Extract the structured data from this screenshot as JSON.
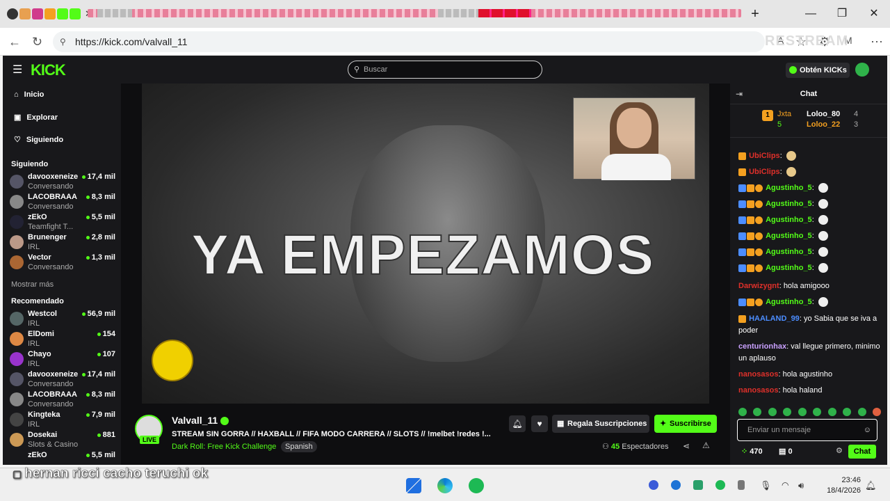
{
  "browser": {
    "url": "https://kick.com/valvall_11",
    "watermark": "RESTREAM",
    "window_controls": {
      "minimize": "—",
      "restore": "❐",
      "close": "✕"
    },
    "new_tab": "+"
  },
  "app": {
    "logo": "KICK",
    "search_placeholder": "Buscar",
    "kicks_label": "Obtén KICKs",
    "nav": [
      {
        "label": "Inicio",
        "icon": "home-icon"
      },
      {
        "label": "Explorar",
        "icon": "explore-icon"
      },
      {
        "label": "Siguiendo",
        "icon": "heart-icon"
      }
    ],
    "following_heading": "Siguiendo",
    "following": [
      {
        "name": "davooxeneize",
        "category": "Conversando",
        "viewers": "17,4 mil"
      },
      {
        "name": "LACOBRAAA",
        "category": "Conversando",
        "viewers": "8,3 mil"
      },
      {
        "name": "zEkO",
        "category": "Teamfight T...",
        "viewers": "5,5 mil"
      },
      {
        "name": "Brunenger",
        "category": "IRL",
        "viewers": "2,8 mil"
      },
      {
        "name": "Vector",
        "category": "Conversando",
        "viewers": "1,3 mil"
      }
    ],
    "show_more": "Mostrar más",
    "recommended_heading": "Recomendado",
    "recommended": [
      {
        "name": "Westcol",
        "category": "IRL",
        "viewers": "56,9 mil"
      },
      {
        "name": "ElDomi",
        "category": "IRL",
        "viewers": "154"
      },
      {
        "name": "Chayo",
        "category": "IRL",
        "viewers": "107"
      },
      {
        "name": "davooxeneize",
        "category": "Conversando",
        "viewers": "17,4 mil"
      },
      {
        "name": "LACOBRAAA",
        "category": "Conversando",
        "viewers": "8,3 mil"
      },
      {
        "name": "Kingteka",
        "category": "IRL",
        "viewers": "7,9 mil"
      },
      {
        "name": "Dosekai",
        "category": "Slots & Casino",
        "viewers": "881"
      },
      {
        "name": "zEkO",
        "category": "",
        "viewers": "5,5 mil"
      }
    ]
  },
  "video": {
    "overlay_text": "YA EMPEZAMOS"
  },
  "stream": {
    "channel": "Valvall_11",
    "live_badge": "LIVE",
    "title": "STREAM SIN GORRA // HAXBALL // FIFA MODO CARRERA // SLOTS // !melbet !redes !...",
    "category": "Dark Roll: Free Kick Challenge",
    "language_tag": "Spanish",
    "gift_label": "Regala Suscripciones",
    "subscribe_label": "Suscribirse",
    "viewers_count": "45",
    "viewers_label": "Espectadores"
  },
  "chat": {
    "heading": "Chat",
    "leaderboard": [
      {
        "name": "Jxta",
        "score": "5"
      },
      {
        "name": "Loloo_80",
        "score": "4"
      },
      {
        "name": "Loloo_22",
        "score": "3"
      }
    ],
    "messages": [
      {
        "user": "UbiClips",
        "text": "",
        "color": "#e0302a"
      },
      {
        "user": "UbiClips",
        "text": "",
        "color": "#e0302a"
      },
      {
        "user": "Agustinho_5",
        "text": "",
        "color": "#53fc18"
      },
      {
        "user": "Agustinho_5",
        "text": "",
        "color": "#53fc18"
      },
      {
        "user": "Agustinho_5",
        "text": "",
        "color": "#53fc18"
      },
      {
        "user": "Agustinho_5",
        "text": "",
        "color": "#53fc18"
      },
      {
        "user": "Agustinho_5",
        "text": "",
        "color": "#53fc18"
      },
      {
        "user": "Agustinho_5",
        "text": "",
        "color": "#53fc18"
      },
      {
        "user": "Darwizygnt",
        "text": "hola amigooo",
        "color": "#e0302a"
      },
      {
        "user": "Agustinho_5",
        "text": "",
        "color": "#53fc18"
      },
      {
        "user": "HAALAND_99",
        "text": "yo Sabia que se iva a poder",
        "color": "#4c8dff"
      },
      {
        "user": "centurionhax",
        "text": "val llegue primero, minimo un aplauso",
        "color": "#c9a0ff"
      },
      {
        "user": "nanosasos",
        "text": "hola agustinho",
        "color": "#e0302a"
      },
      {
        "user": "nanosasos",
        "text": "hola haland",
        "color": "#e0302a"
      }
    ],
    "input_placeholder": "Enviar un mensaje",
    "points": "470",
    "gifts": "0",
    "send_label": "Chat"
  },
  "caption": "hernan ricci cacho teruchi ok",
  "taskbar": {
    "time": "23:46",
    "date": "18/4/2026"
  }
}
